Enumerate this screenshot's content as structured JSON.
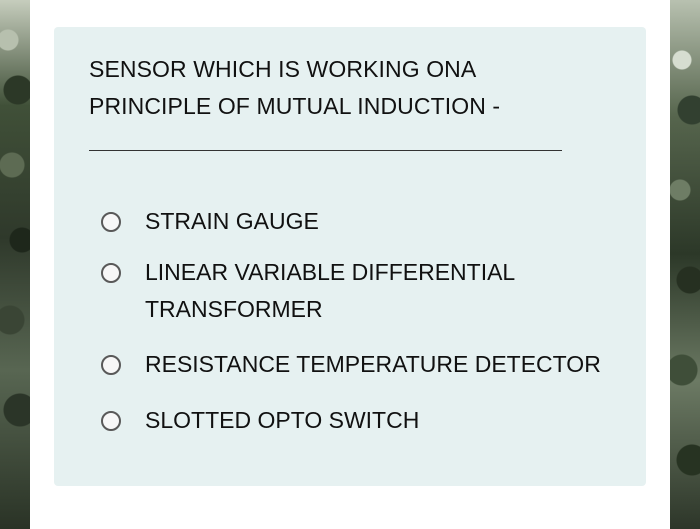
{
  "question": {
    "line1": "SENSOR WHICH IS WORKING ONA",
    "line2": "PRINCIPLE OF MUTUAL INDUCTION -"
  },
  "options": [
    {
      "line1": "STRAIN GAUGE"
    },
    {
      "line1": "LINEAR VARIABLE DIFFERENTIAL",
      "line2": "TRANSFORMER"
    },
    {
      "line1": "RESISTANCE TEMPERATURE DETECTOR"
    },
    {
      "line1": "SLOTTED OPTO SWITCH"
    }
  ],
  "colors": {
    "card_background": "#e6f1f1",
    "text": "#111111",
    "radio_border": "#595959"
  }
}
